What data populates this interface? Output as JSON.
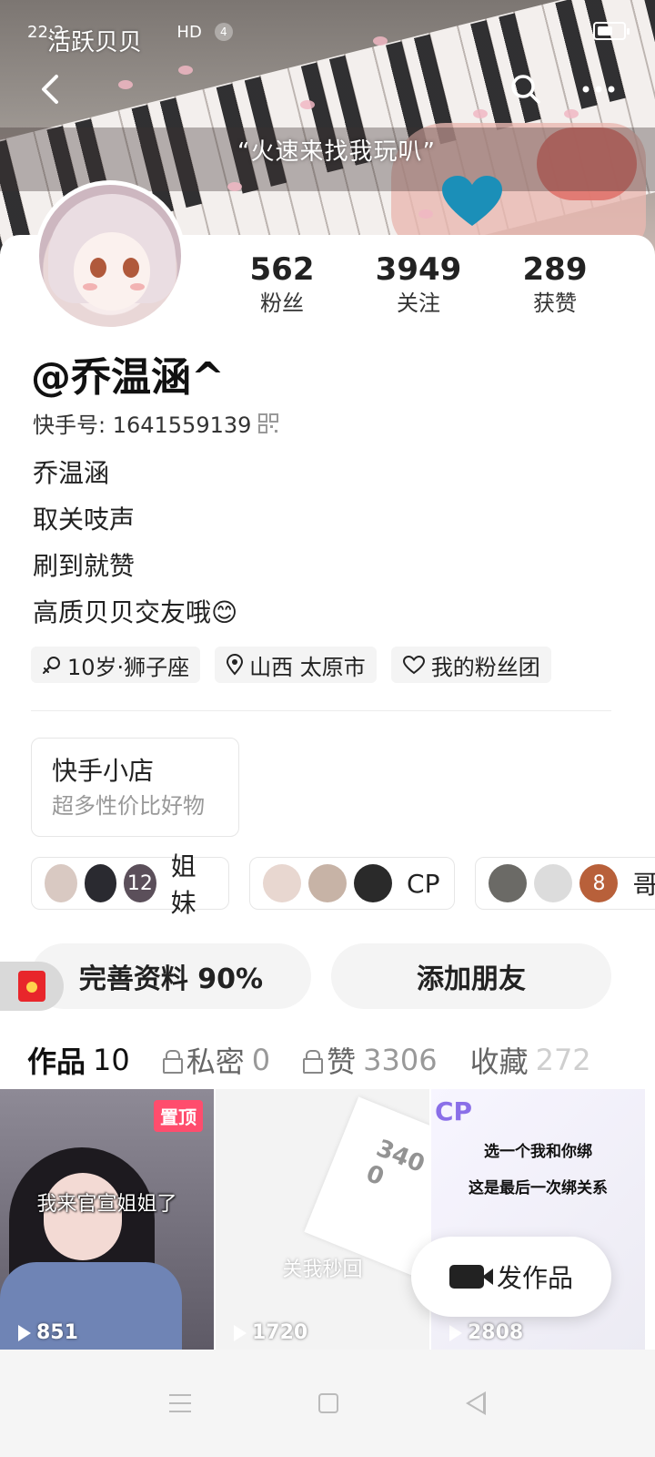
{
  "status_bar": {
    "time": "22:2",
    "network": "HD",
    "notification_count": "4"
  },
  "header": {
    "title": "活跃贝贝",
    "banner_text": "“火速来找我玩叭”"
  },
  "profile": {
    "nickname": "@乔温涵^",
    "kuaishou_id_label": "快手号: 1641559139",
    "bio_lines": [
      "乔温涵",
      "取关吱声",
      "刷到就赞",
      "高质贝贝交友哦😊"
    ]
  },
  "stats": [
    {
      "value": "562",
      "label": "粉丝"
    },
    {
      "value": "3949",
      "label": "关注"
    },
    {
      "value": "289",
      "label": "获赞"
    }
  ],
  "tags": [
    {
      "text": "10岁·狮子座",
      "icon": "gender-female-icon"
    },
    {
      "text": "山西 太原市",
      "icon": "location-pin-icon"
    },
    {
      "text": "我的粉丝团",
      "icon": "heart-icon"
    }
  ],
  "shop": {
    "title": "快手小店",
    "subtitle": "超多性价比好物"
  },
  "groups": [
    {
      "label": "姐妹",
      "avatars": [
        "",
        "",
        "12"
      ]
    },
    {
      "label": "CP",
      "avatars": [
        "",
        "",
        ""
      ]
    },
    {
      "label": "哥",
      "avatars": [
        "",
        "",
        "8"
      ]
    }
  ],
  "actions": {
    "complete_profile": "完善资料 90%",
    "add_friend": "添加朋友"
  },
  "tabs": [
    {
      "label": "作品",
      "count": "10",
      "locked": false
    },
    {
      "label": "私密",
      "count": "0",
      "locked": true
    },
    {
      "label": "赞",
      "count": "3306",
      "locked": true
    },
    {
      "label": "收藏",
      "count": "272",
      "locked": false
    }
  ],
  "posts": [
    {
      "caption": "我来官宣姐姐了",
      "plays": "851",
      "pinned_label": "置顶"
    },
    {
      "caption": "关我秒回",
      "paper_text": "340 0",
      "plays": "1720"
    },
    {
      "caption_line1": "选一个我和你绑",
      "caption_line2": "这是最后一次绑关系",
      "plays": "2808",
      "cp_mark": "CP"
    }
  ],
  "publish_button": "发作品",
  "colors": {
    "pin_badge": "#ff4d6d",
    "red_packet": "#e8262b",
    "accent": "#222222"
  }
}
